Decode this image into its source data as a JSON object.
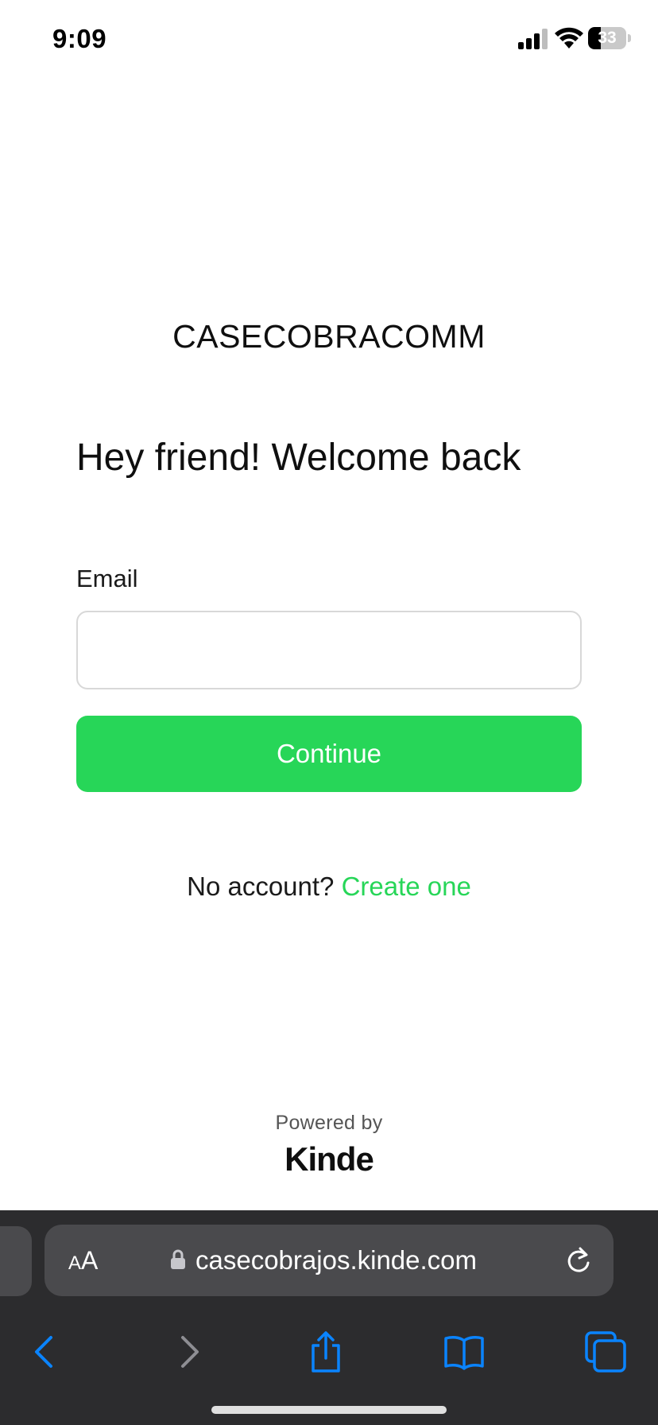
{
  "status_bar": {
    "time": "9:09",
    "battery_level": "33",
    "icons": [
      "signal-icon",
      "wifi-icon",
      "battery-icon"
    ]
  },
  "brand_name": "CASECOBRACOMM",
  "heading": "Hey friend! Welcome back",
  "form": {
    "email_label": "Email",
    "email_value": "",
    "continue_label": "Continue"
  },
  "signup": {
    "prompt": "No account?",
    "link_label": "Create one"
  },
  "footer": {
    "powered_by": "Powered by",
    "provider": "Kinde"
  },
  "browser": {
    "text_size_small": "A",
    "text_size_large": "A",
    "url": "casecobrajos.kinde.com",
    "toolbar_icons": [
      "back-icon",
      "forward-icon",
      "share-icon",
      "bookmarks-icon",
      "tabs-icon"
    ]
  },
  "colors": {
    "accent": "#27d658",
    "browser_bar": "#2c2c2e",
    "browser_accent": "#0a84ff",
    "disabled": "#8e8e93"
  }
}
